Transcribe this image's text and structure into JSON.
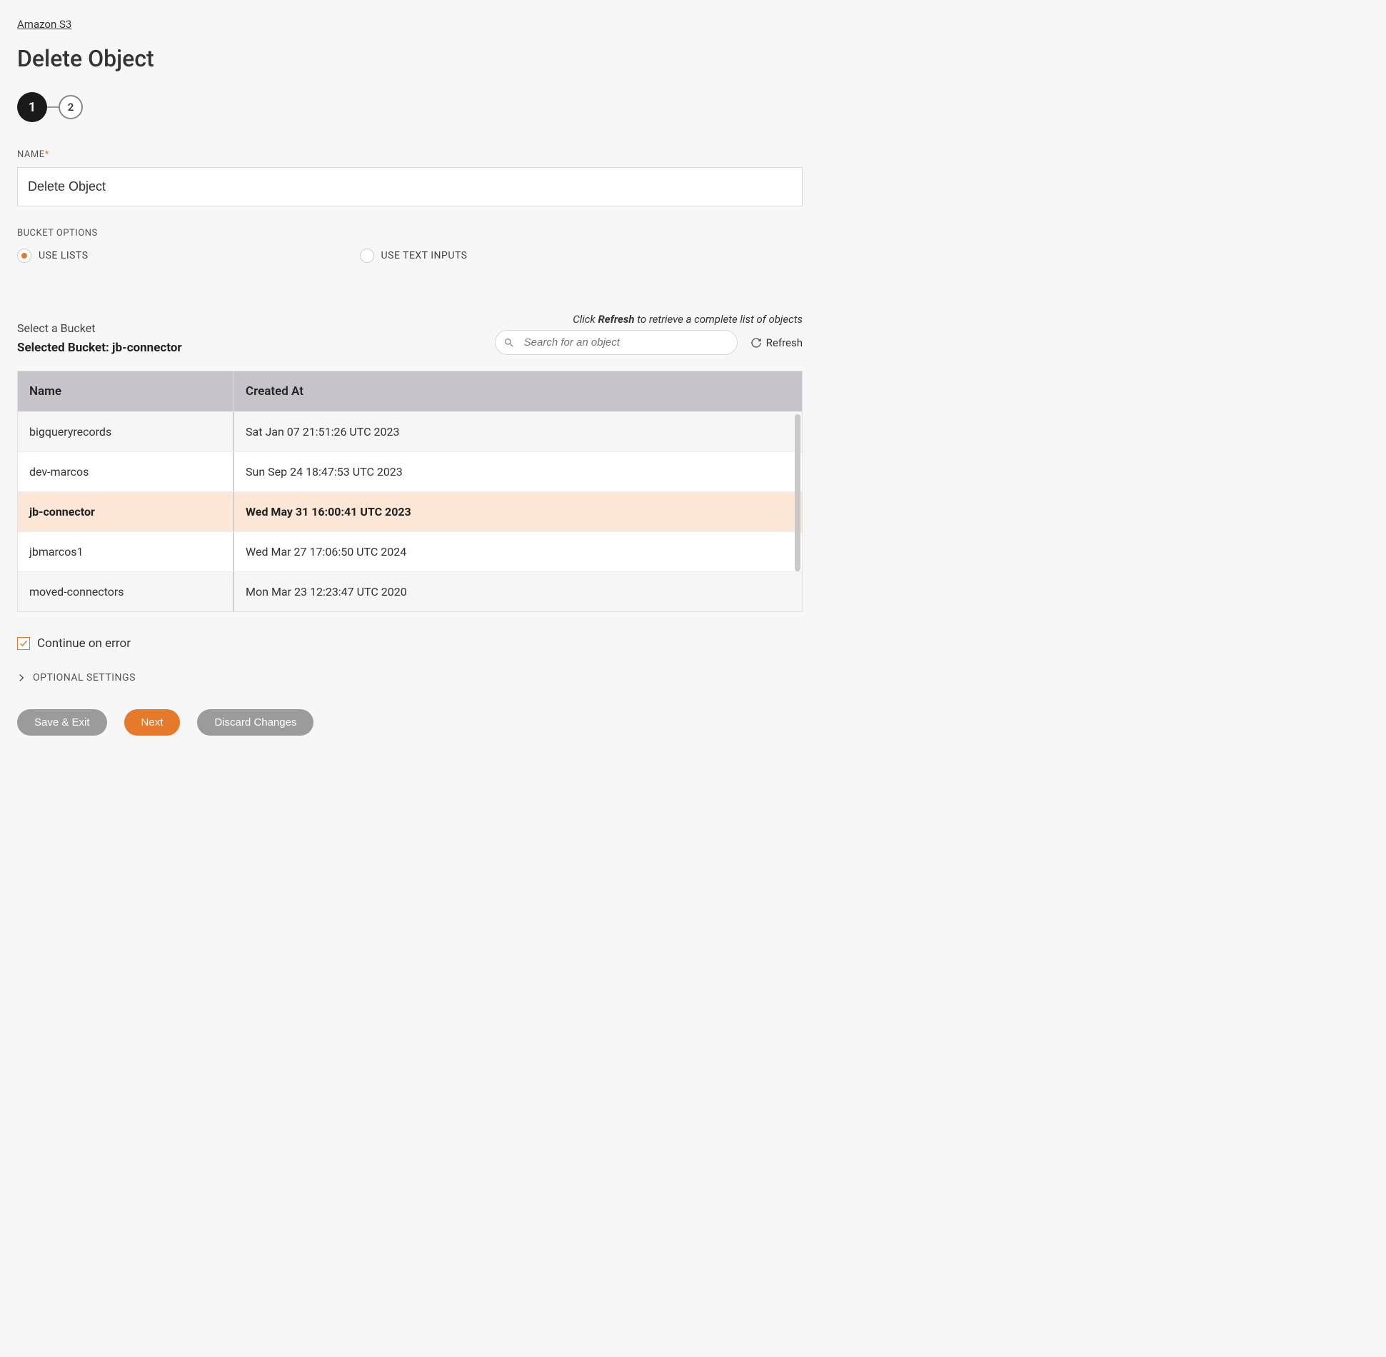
{
  "breadcrumb": "Amazon S3",
  "page_title": "Delete Object",
  "stepper": {
    "steps": [
      "1",
      "2"
    ],
    "active_index": 0
  },
  "name_field": {
    "label": "NAME",
    "required_marker": "*",
    "value": "Delete Object"
  },
  "bucket_options": {
    "label": "BUCKET OPTIONS",
    "options": [
      {
        "label": "USE LISTS",
        "selected": true
      },
      {
        "label": "USE TEXT INPUTS",
        "selected": false
      }
    ]
  },
  "bucket_section": {
    "select_label": "Select a Bucket",
    "selected_prefix": "Selected Bucket: ",
    "selected_value": "jb-connector",
    "refresh_hint_pre": "Click ",
    "refresh_hint_bold": "Refresh",
    "refresh_hint_post": " to retrieve a complete list of objects",
    "search_placeholder": "Search for an object",
    "refresh_label": "Refresh"
  },
  "table": {
    "headers": {
      "name": "Name",
      "created": "Created At"
    },
    "rows": [
      {
        "name": "bigqueryrecords",
        "created": "Sat Jan 07 21:51:26 UTC 2023",
        "selected": false
      },
      {
        "name": "dev-marcos",
        "created": "Sun Sep 24 18:47:53 UTC 2023",
        "selected": false
      },
      {
        "name": "jb-connector",
        "created": "Wed May 31 16:00:41 UTC 2023",
        "selected": true
      },
      {
        "name": "jbmarcos1",
        "created": "Wed Mar 27 17:06:50 UTC 2024",
        "selected": false
      },
      {
        "name": "moved-connectors",
        "created": "Mon Mar 23 12:23:47 UTC 2020",
        "selected": false
      }
    ]
  },
  "continue_on_error": {
    "label": "Continue on error",
    "checked": true
  },
  "optional_settings": {
    "label": "OPTIONAL SETTINGS"
  },
  "buttons": {
    "save_exit": "Save & Exit",
    "next": "Next",
    "discard": "Discard Changes"
  }
}
